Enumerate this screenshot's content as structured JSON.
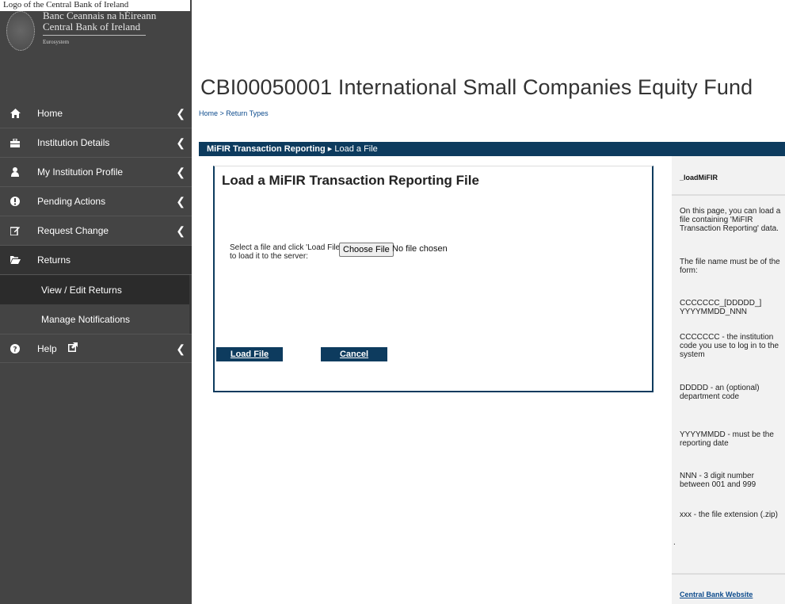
{
  "header": {
    "image_alt": "Logo of the Central Bank of Ireland",
    "logo_line1": "Banc Ceannais na hÉireann",
    "logo_line2": "Central Bank of Ireland",
    "logo_line3": "Eurosystem"
  },
  "sidebar": {
    "items": [
      {
        "label": "Home",
        "icon": "home-icon"
      },
      {
        "label": "Institution Details",
        "icon": "briefcase-icon"
      },
      {
        "label": "My Institution Profile",
        "icon": "user-icon"
      },
      {
        "label": "Pending Actions",
        "icon": "exclamation-icon"
      },
      {
        "label": "Request Change",
        "icon": "edit-icon"
      },
      {
        "label": "Returns",
        "icon": "folder-open-icon"
      },
      {
        "label": "View / Edit Returns"
      },
      {
        "label": "Manage Notifications"
      },
      {
        "label": "Help",
        "icon": "question-icon"
      }
    ]
  },
  "main": {
    "title": "CBI00050001 International Small Companies Equity Fund",
    "breadcrumb": "Home > Return Types",
    "bar_section": "MiFIR Transaction Reporting",
    "bar_page": "Load a File",
    "form_title": "Load a MiFIR Transaction Reporting File",
    "form_label": "Select a file and click 'Load File' to load it to the server:",
    "choose_file": "Choose File",
    "no_file": "No file chosen",
    "load_button": "Load File",
    "cancel_button": "Cancel"
  },
  "help": {
    "title": "_loadMiFIR",
    "paragraphs": [
      "On this page, you can load a file containing 'MiFIR Transaction Reporting' data.",
      "The file name must be of the form:",
      "CCCCCCC_[DDDDD_] YYYYMMDD_NNN",
      "CCCCCCC - the institution code you use to log in to the system",
      "DDDDD - an (optional) department code",
      "YYYYMMDD - must be the reporting date",
      "NNN - 3 digit number between 001 and 999",
      "xxx - the file extension (.zip)",
      "."
    ],
    "link": "Central Bank Website"
  },
  "colors": {
    "sidebar_bg": "#444444",
    "accent_navy": "#0d3b5e",
    "link_blue": "#0b4a8c"
  }
}
